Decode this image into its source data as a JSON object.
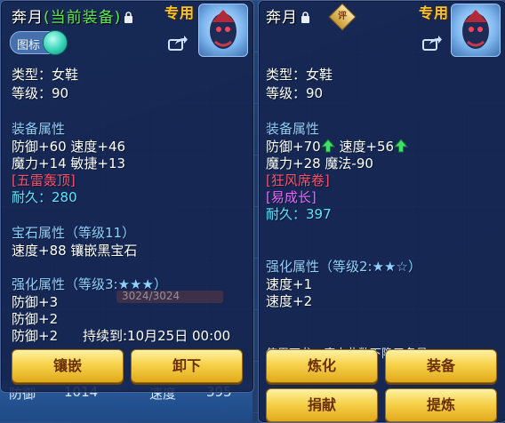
{
  "panels": [
    {
      "title": "奔月",
      "title_suffix": "(当前装备)",
      "special": "专用",
      "toggle_label": "图标",
      "type_line": "类型：女鞋",
      "level_line": "等级：90",
      "equip_attr_header": "装备属性",
      "attr_line1": "防御+60 速度+46",
      "attr_line2": "魔力+14 敏捷+13",
      "special_skill": "[五雷轰顶]",
      "durability_label": "耐久：",
      "durability_value": "280",
      "gem_header": "宝石属性（等级11）",
      "gem_line": "速度+88 镶嵌黑宝石",
      "enhance_header": "强化属性（等级3:★★★）",
      "enhance_lines": [
        "防御+3",
        "防御+2",
        "防御+2"
      ],
      "duration": "持续到:10月25日 00:00",
      "buttons": [
        "镶嵌",
        "卸下"
      ]
    },
    {
      "title": "奔月",
      "seal_char": "评",
      "special": "专用",
      "type_line": "类型：女鞋",
      "level_line": "等级：90",
      "equip_attr_header": "装备属性",
      "attr_line1a": "防御+70",
      "attr_line1b": "速度+56",
      "attr_line2": "魔力+28 魔法-90",
      "special_skill": "[狂风席卷]",
      "special_effect": "[易成长]",
      "durability_label": "耐久：",
      "durability_value": "397",
      "enhance_header": "强化属性（等级2:★★☆）",
      "enhance_lines": [
        "速度+1",
        "速度+2"
      ],
      "cut_text": "使用万龙一座土此数下隐五名号",
      "buttons": [
        "炼化",
        "装备",
        "捐献",
        "提炼"
      ]
    }
  ],
  "background": {
    "faint_bar": "3024/3024",
    "bottom_left": "防御",
    "bottom_left_value": "1014",
    "bottom_mid": "速度",
    "bottom_right_value": "395"
  },
  "colors": {
    "gold": "#f8c428",
    "green": "#5dea4e",
    "red": "#ff4f6a",
    "cyan": "#5de6ff",
    "magenta": "#e768ff",
    "section": "#8fd0ff"
  }
}
